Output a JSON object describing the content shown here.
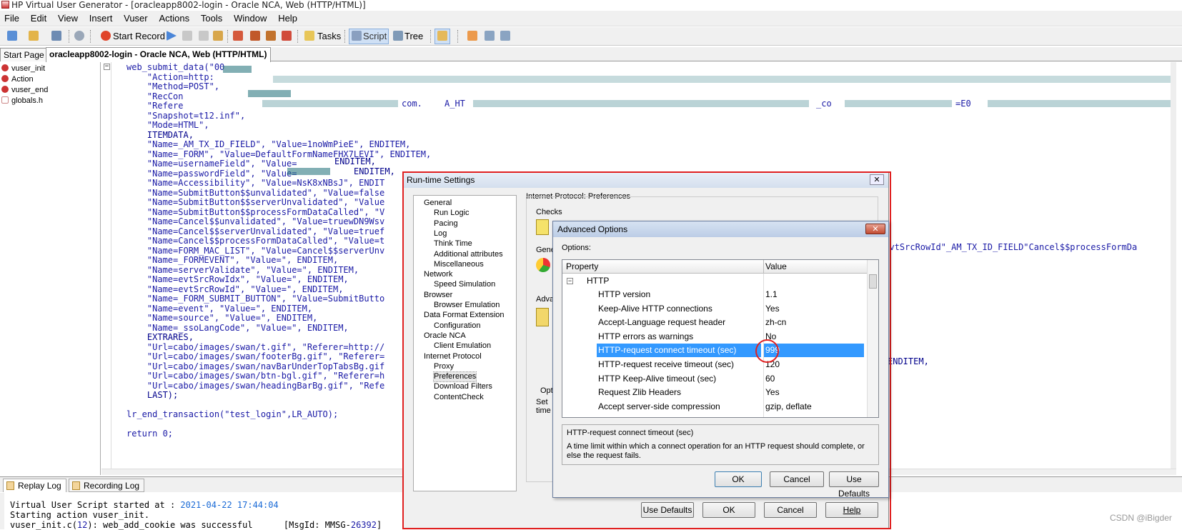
{
  "window": {
    "title": "HP Virtual User Generator - [oracleapp8002-login - Oracle NCA, Web (HTTP/HTML)]"
  },
  "menu": [
    "File",
    "Edit",
    "View",
    "Insert",
    "Vuser",
    "Actions",
    "Tools",
    "Window",
    "Help"
  ],
  "toolbar": {
    "start_record": "Start Record",
    "tasks": "Tasks",
    "script": "Script",
    "tree": "Tree"
  },
  "doc_tabs": [
    "Start Page",
    "oracleapp8002-login - Oracle NCA, Web (HTTP/HTML)"
  ],
  "tree_items": [
    "vuser_init",
    "Action",
    "vuser_end",
    "globals.h"
  ],
  "code_lines": [
    "web_submit_data(\"00",
    "    \"Action=http:",
    "    \"Method=POST\",",
    "    \"RecCon",
    "    \"Refere",
    "    \"Snapshot=t12.inf\",",
    "    \"Mode=HTML\",",
    "    ITEMDATA,",
    "    \"Name=_AM_TX_ID_FIELD\", \"Value=1noWmPieE\", ENDITEM,",
    "    \"Name=_FORM\", \"Value=DefaultFormNameFHX7LEVI\", ENDITEM,",
    "    \"Name=usernameField\", \"Value=",
    "    \"Name=passwordField\", \"Value=",
    "    \"Name=Accessibility\", \"Value=NsK8xNBsJ\", ENDIT",
    "    \"Name=SubmitButton$$unvalidated\", \"Value=false",
    "    \"Name=SubmitButton$$serverUnvalidated\", \"Value",
    "    \"Name=SubmitButton$$processFormDataCalled\", \"V",
    "    \"Name=Cancel$$unvalidated\", \"Value=truewDN9Wsv",
    "    \"Name=Cancel$$serverUnvalidated\", \"Value=truef",
    "    \"Name=Cancel$$processFormDataCalled\", \"Value=t",
    "    \"Name=FORM_MAC_LIST\", \"Value=Cancel$$serverUnv",
    "    \"Name=_FORMEVENT\", \"Value=\", ENDITEM,",
    "    \"Name=serverValidate\", \"Value=\", ENDITEM,",
    "    \"Name=evtSrcRowIdx\", \"Value=\", ENDITEM,",
    "    \"Name=evtSrcRowId\", \"Value=\", ENDITEM,",
    "    \"Name=_FORM_SUBMIT_BUTTON\", \"Value=SubmitButto",
    "    \"Name=event\", \"Value=\", ENDITEM,",
    "    \"Name=source\", \"Value=\", ENDITEM,",
    "    \"Name=_ssoLangCode\", \"Value=\", ENDITEM,",
    "    EXTRARES,",
    "    \"Url=cabo/images/swan/t.gif\", \"Referer=http://",
    "    \"Url=cabo/images/swan/footerBg.gif\", \"Referer=",
    "    \"Url=cabo/images/swan/navBarUnderTopTabsBg.gif",
    "    \"Url=cabo/images/swan/btn-bgl.gif\", \"Referer=h",
    "    \"Url=cabo/images/swan/headingBarBg.gif\", \"Refe",
    "    LAST);",
    "",
    "lr_end_transaction(\"test_login\",LR_AUTO);",
    "",
    "return 0;"
  ],
  "code_fragments": {
    "form_mac_right": "\"evtSrcRowId\"_AM_TX_ID_FIELD\"Cancel$$processFormDa",
    "enditem_right": "ENDITEM,",
    "refere_right": "com.",
    "refere_right2": "A_HT",
    "refere_co": "_co",
    "refere_e0": "=E0",
    "usern_tail": "ENDITEM,",
    "pass_tail": "ENDITEM,"
  },
  "log_tabs": [
    "Replay Log",
    "Recording Log"
  ],
  "log_lines": [
    {
      "text": "Virtual User Script started at : ",
      "date": "2021-04-22 17:44:04"
    },
    {
      "text": "Starting action vuser_init."
    },
    {
      "pre": "vuser_init.c(",
      "num": "12",
      "post": "): web_add_cookie was successful      [MsgId: MMSG-",
      "num2": "26392",
      "end": "]"
    }
  ],
  "rts": {
    "title": "Run-time Settings",
    "group_label": "Internet Protocol: Preferences",
    "checks": "Checks",
    "gene": "Gene",
    "adva": "Adva",
    "opt": "Opt",
    "set": "Set",
    "time": "time",
    "nav": [
      {
        "label": "General",
        "level": 0
      },
      {
        "label": "Run Logic",
        "level": 1
      },
      {
        "label": "Pacing",
        "level": 1
      },
      {
        "label": "Log",
        "level": 1
      },
      {
        "label": "Think Time",
        "level": 1
      },
      {
        "label": "Additional attributes",
        "level": 1
      },
      {
        "label": "Miscellaneous",
        "level": 1
      },
      {
        "label": "Network",
        "level": 0
      },
      {
        "label": "Speed Simulation",
        "level": 1
      },
      {
        "label": "Browser",
        "level": 0
      },
      {
        "label": "Browser Emulation",
        "level": 1
      },
      {
        "label": "Data Format Extension",
        "level": 0
      },
      {
        "label": "Configuration",
        "level": 1
      },
      {
        "label": "Oracle NCA",
        "level": 0
      },
      {
        "label": "Client Emulation",
        "level": 1
      },
      {
        "label": "Internet Protocol",
        "level": 0
      },
      {
        "label": "Proxy",
        "level": 1
      },
      {
        "label": "Preferences",
        "level": 1
      },
      {
        "label": "Download Filters",
        "level": 1
      },
      {
        "label": "ContentCheck",
        "level": 1
      }
    ],
    "buttons": {
      "use_defaults": "Use Defaults",
      "ok": "OK",
      "cancel": "Cancel",
      "help": "Help"
    }
  },
  "adv": {
    "title": "Advanced Options",
    "options_label": "Options:",
    "col_property": "Property",
    "col_value": "Value",
    "group": "HTTP",
    "rows": [
      {
        "property": "HTTP version",
        "value": "1.1"
      },
      {
        "property": "Keep-Alive HTTP connections",
        "value": "Yes"
      },
      {
        "property": "Accept-Language request header",
        "value": "zh-cn"
      },
      {
        "property": "HTTP errors as warnings",
        "value": "No"
      },
      {
        "property": "HTTP-request connect timeout (sec)",
        "value": "999",
        "selected": true
      },
      {
        "property": "HTTP-request receive timeout (sec)",
        "value": "120"
      },
      {
        "property": "HTTP Keep-Alive timeout (sec)",
        "value": "60"
      },
      {
        "property": "Request Zlib Headers",
        "value": "Yes"
      },
      {
        "property": "Accept server-side compression",
        "value": "gzip, deflate"
      }
    ],
    "desc_title": "HTTP-request connect timeout (sec)",
    "desc_text": "A time limit within which a connect operation for an HTTP request should complete, or else the request fails.",
    "buttons": {
      "ok": "OK",
      "cancel": "Cancel",
      "use_defaults": "Use Defaults"
    }
  },
  "watermark": "CSDN @iBigder"
}
